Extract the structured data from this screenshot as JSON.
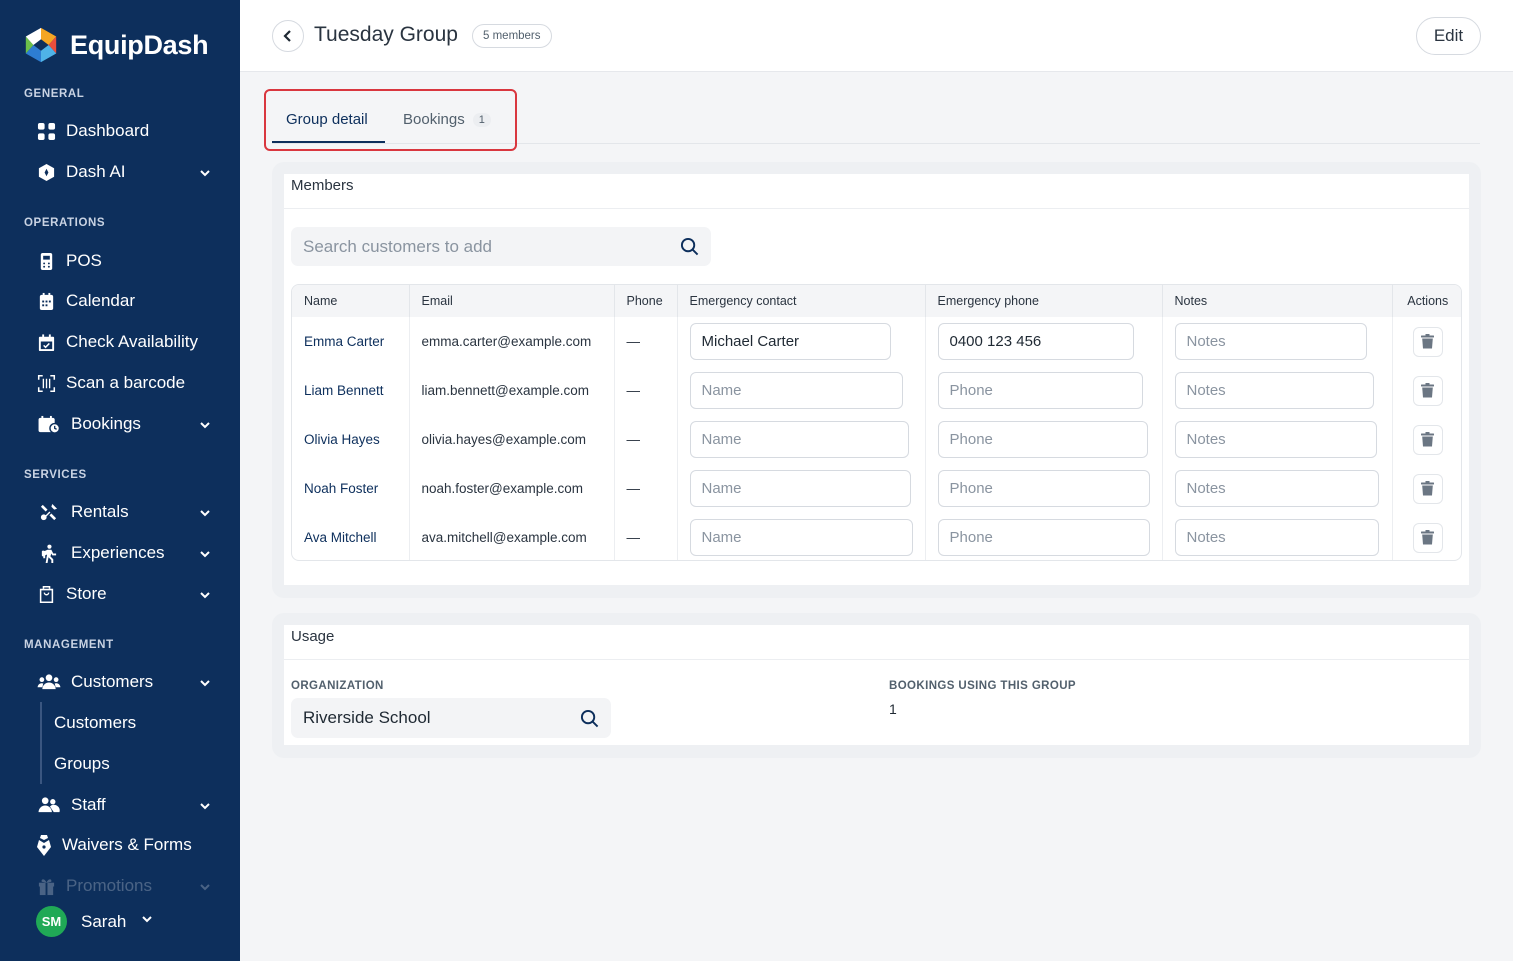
{
  "app": {
    "name": "EquipDash"
  },
  "sidebar": {
    "sections": {
      "general": "GENERAL",
      "operations": "OPERATIONS",
      "services": "SERVICES",
      "management": "MANAGEMENT"
    },
    "items": {
      "dashboard": "Dashboard",
      "dash_ai": "Dash AI",
      "pos": "POS",
      "calendar": "Calendar",
      "check_availability": "Check Availability",
      "scan_barcode": "Scan a barcode",
      "bookings": "Bookings",
      "rentals": "Rentals",
      "experiences": "Experiences",
      "store": "Store",
      "customers": "Customers",
      "customers_sub": "Customers",
      "groups_sub": "Groups",
      "staff": "Staff",
      "waivers": "Waivers & Forms",
      "promotions": "Promotions"
    },
    "user": {
      "initials": "SM",
      "name": "Sarah"
    }
  },
  "header": {
    "title": "Tuesday Group",
    "member_badge": "5 members",
    "edit_label": "Edit"
  },
  "tabs": [
    {
      "label": "Group detail",
      "active": true
    },
    {
      "label": "Bookings",
      "count": "1",
      "active": false
    }
  ],
  "members": {
    "title": "Members",
    "search_placeholder": "Search customers to add",
    "columns": [
      "Name",
      "Email",
      "Phone",
      "Emergency contact",
      "Emergency phone",
      "Notes",
      "Actions"
    ],
    "rows": [
      {
        "name": "Emma Carter",
        "email": "emma.carter@example.com",
        "phone": "—",
        "emergency_contact": "Michael Carter",
        "emergency_phone": "0400 123 456",
        "notes": ""
      },
      {
        "name": "Liam Bennett",
        "email": "liam.bennett@example.com",
        "phone": "—",
        "emergency_contact": "",
        "emergency_phone": "",
        "notes": ""
      },
      {
        "name": "Olivia Hayes",
        "email": "olivia.hayes@example.com",
        "phone": "—",
        "emergency_contact": "",
        "emergency_phone": "",
        "notes": ""
      },
      {
        "name": "Noah Foster",
        "email": "noah.foster@example.com",
        "phone": "—",
        "emergency_contact": "",
        "emergency_phone": "",
        "notes": ""
      },
      {
        "name": "Ava Mitchell",
        "email": "ava.mitchell@example.com",
        "phone": "—",
        "emergency_contact": "",
        "emergency_phone": "",
        "notes": ""
      }
    ],
    "placeholders": {
      "name": "Name",
      "phone": "Phone",
      "notes": "Notes"
    }
  },
  "usage": {
    "title": "Usage",
    "organization_label": "ORGANIZATION",
    "organization_value": "Riverside School",
    "bookings_label": "BOOKINGS USING THIS GROUP",
    "bookings_value": "1"
  },
  "colors": {
    "sidebar_bg": "#0d2f5c",
    "accent": "#0d2f5c",
    "highlight_border": "#d9373f",
    "avatar_bg": "#20a956"
  }
}
